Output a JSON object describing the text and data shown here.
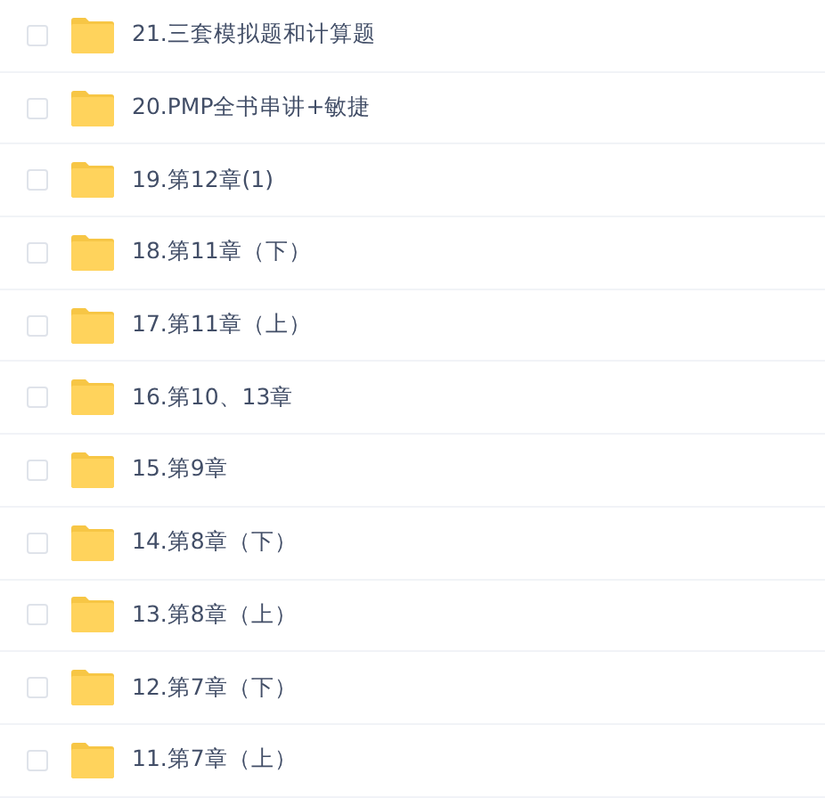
{
  "files": [
    {
      "name": "21.三套模拟题和计算题",
      "checked": false
    },
    {
      "name": "20.PMP全书串讲+敏捷",
      "checked": false
    },
    {
      "name": "19.第12章(1)",
      "checked": false
    },
    {
      "name": "18.第11章（下）",
      "checked": false
    },
    {
      "name": "17.第11章（上）",
      "checked": false
    },
    {
      "name": "16.第10、13章",
      "checked": false
    },
    {
      "name": "15.第9章",
      "checked": false
    },
    {
      "name": "14.第8章（下）",
      "checked": false
    },
    {
      "name": "13.第8章（上）",
      "checked": false
    },
    {
      "name": "12.第7章（下）",
      "checked": false
    },
    {
      "name": "11.第7章（上）",
      "checked": false
    }
  ]
}
